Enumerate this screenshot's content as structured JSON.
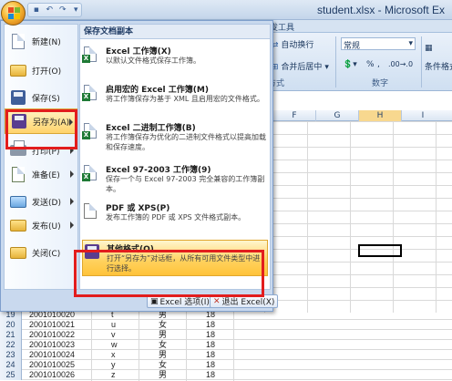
{
  "window": {
    "title": "student.xlsx - Microsoft Ex"
  },
  "ribbon": {
    "tab_partial": "发工具",
    "wrap_text": "自动换行",
    "number_format": "常规",
    "merge_center": "合并后居中",
    "percent": "%",
    "comma": ",",
    "dec_inc": ".00→.0",
    "group_alignment": "方式",
    "group_number": "数字",
    "cond_format": "条件格式"
  },
  "sheet": {
    "columns": [
      "F",
      "G",
      "H",
      "I"
    ],
    "selected_column": "H",
    "rows": [
      {
        "n": "19",
        "id": "2001010020",
        "name": "t",
        "sex": "男",
        "age": "18"
      },
      {
        "n": "20",
        "id": "2001010021",
        "name": "u",
        "sex": "女",
        "age": "18"
      },
      {
        "n": "21",
        "id": "2001010022",
        "name": "v",
        "sex": "男",
        "age": "18"
      },
      {
        "n": "22",
        "id": "2001010023",
        "name": "w",
        "sex": "女",
        "age": "18"
      },
      {
        "n": "23",
        "id": "2001010024",
        "name": "x",
        "sex": "男",
        "age": "18"
      },
      {
        "n": "24",
        "id": "2001010025",
        "name": "y",
        "sex": "女",
        "age": "18"
      },
      {
        "n": "25",
        "id": "2001010026",
        "name": "z",
        "sex": "男",
        "age": "18"
      }
    ]
  },
  "menu": {
    "items": [
      {
        "label": "新建(N)",
        "icon": "new-doc-icon",
        "arrow": false
      },
      {
        "label": "打开(O)",
        "icon": "open-folder-icon",
        "arrow": false
      },
      {
        "label": "保存(S)",
        "icon": "save-disk-icon",
        "arrow": false
      },
      {
        "label": "另存为(A)",
        "icon": "save-as-icon",
        "arrow": true
      },
      {
        "label": "打印(P)",
        "icon": "printer-icon",
        "arrow": true
      },
      {
        "label": "准备(E)",
        "icon": "prepare-icon",
        "arrow": true
      },
      {
        "label": "发送(D)",
        "icon": "send-icon",
        "arrow": true
      },
      {
        "label": "发布(U)",
        "icon": "publish-icon",
        "arrow": true
      },
      {
        "label": "关闭(C)",
        "icon": "close-folder-icon",
        "arrow": false
      }
    ],
    "submenu_title": "保存文档副本",
    "submenu": [
      {
        "title": "Excel 工作簿(X)",
        "desc": "以默认文件格式保存工作簿。"
      },
      {
        "title": "启用宏的 Excel 工作簿(M)",
        "desc": "将工作簿保存为基于 XML 且启用宏的文件格式。"
      },
      {
        "title": "Excel 二进制工作簿(B)",
        "desc": "将工作簿保存为优化的二进制文件格式以提高加载和保存速度。"
      },
      {
        "title": "Excel 97-2003 工作簿(9)",
        "desc": "保存一个与 Excel 97-2003 完全兼容的工作簿副本。"
      },
      {
        "title": "PDF 或 XPS(P)",
        "desc": "发布工作簿的 PDF 或 XPS 文件格式副本。"
      },
      {
        "title": "其他格式(O)",
        "desc": "打开“另存为”对话框，从所有可用文件类型中进行选择。"
      }
    ],
    "footer": {
      "options": "Excel 选项(I)",
      "exit": "退出 Excel(X)"
    }
  }
}
